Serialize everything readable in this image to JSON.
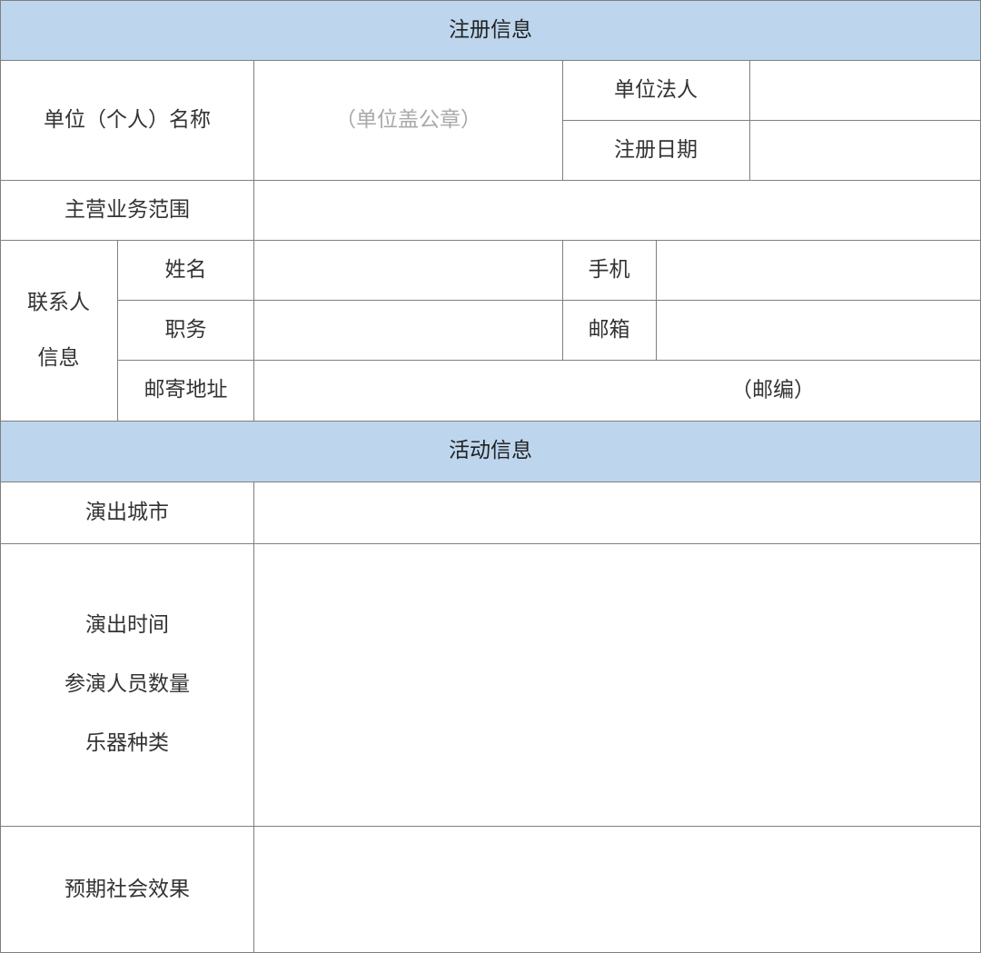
{
  "sections": {
    "registration": {
      "title": "注册信息",
      "unit_name_label": "单位（个人）名称",
      "unit_name_placeholder": "（单位盖公章）",
      "legal_person_label": "单位法人",
      "registration_date_label": "注册日期",
      "business_scope_label": "主营业务范围",
      "contact_group_line1": "联系人",
      "contact_group_line2": "信息",
      "name_label": "姓名",
      "mobile_label": "手机",
      "position_label": "职务",
      "email_label": "邮箱",
      "mailing_address_label": "邮寄地址",
      "postcode_label": "（邮编）"
    },
    "activity": {
      "title": "活动信息",
      "performance_city_label": "演出城市",
      "performance_time_label": "演出时间",
      "participants_count_label": "参演人员数量",
      "instrument_types_label": "乐器种类",
      "expected_social_effect_label": "预期社会效果"
    }
  },
  "colors": {
    "section_header_bg": "#bdd6ee",
    "border": "#7f7f7f",
    "placeholder_text": "#a9a9a9"
  }
}
